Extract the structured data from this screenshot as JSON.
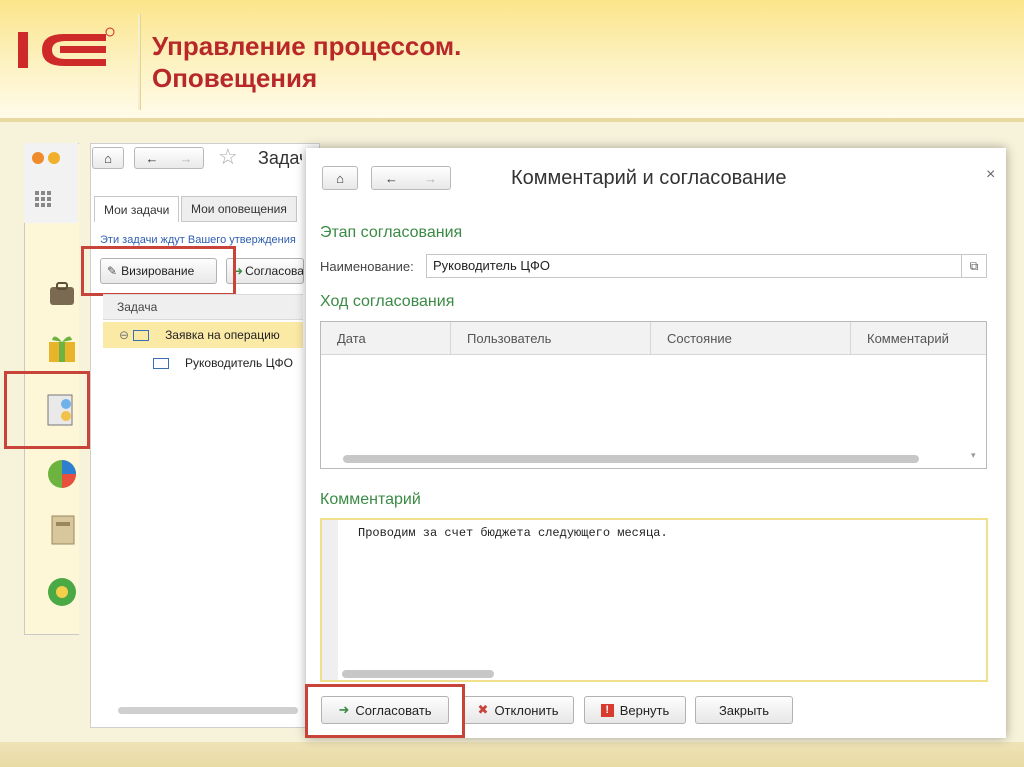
{
  "slide": {
    "title_line1": "Управление процессом.",
    "title_line2": "Оповещения",
    "logo_text": "1С",
    "colors": {
      "title": "#b8282a",
      "accent": "#3b8a45",
      "highlight": "#c8443a"
    }
  },
  "background_window": {
    "title": "Задачи",
    "tabs": [
      "Мои задачи",
      "Мои оповещения"
    ],
    "info_text": "Эти задачи ждут Вашего утверждения",
    "buttons": {
      "visa": "Визирование",
      "approve": "Согласовать"
    },
    "list_header": "Задача",
    "rows": [
      {
        "label": "Заявка на операцию",
        "icon": "document-icon",
        "selected": true
      },
      {
        "label": "Руководитель ЦФО",
        "icon": "route-icon",
        "selected": false
      }
    ]
  },
  "dialog": {
    "title": "Комментарий и согласование",
    "close_symbol": "×",
    "stage_section": "Этап согласования",
    "name_label": "Наименование:",
    "name_value": "Руководитель ЦФО",
    "progress_section": "Ход согласования",
    "columns": [
      "Дата",
      "Пользователь",
      "Состояние",
      "Комментарий"
    ],
    "comment_section": "Комментарий",
    "comment_text": "Проводим за счет бюджета следующего месяца.",
    "buttons": {
      "approve": "Согласовать",
      "reject": "Отклонить",
      "return": "Вернуть",
      "close": "Закрыть"
    }
  }
}
